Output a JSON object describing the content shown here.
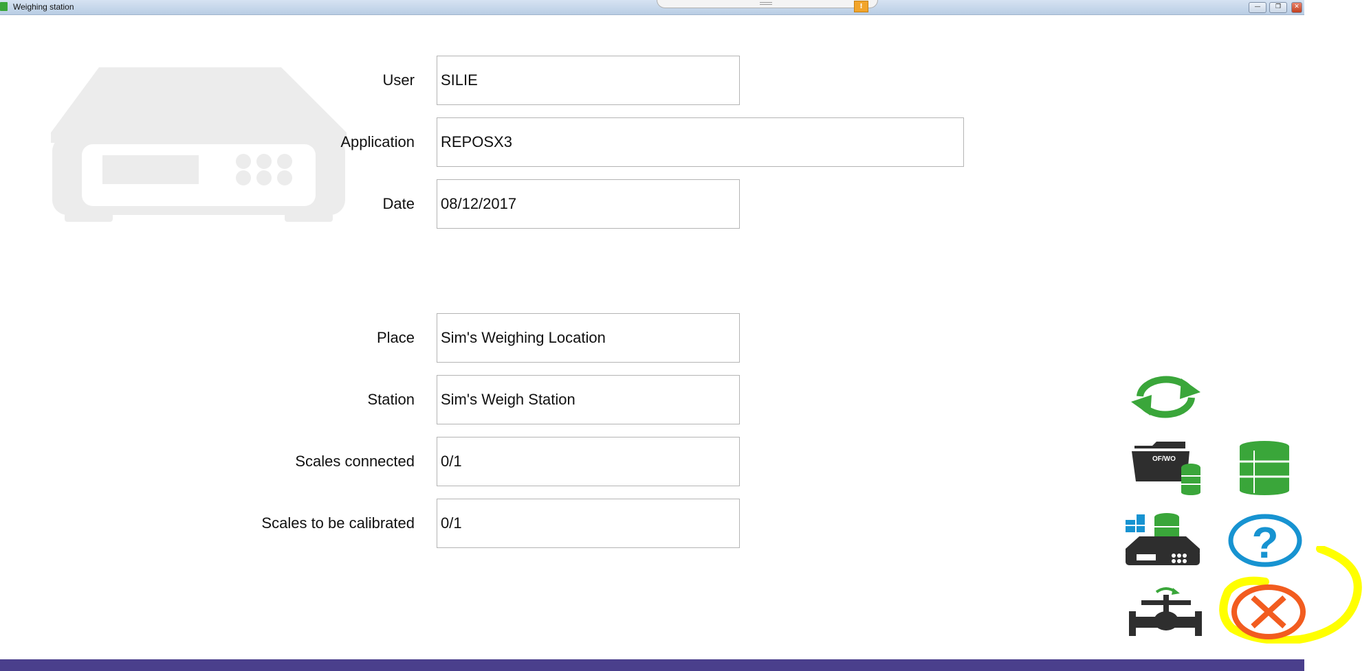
{
  "window": {
    "title": "Weighing station",
    "warning_glyph": "!",
    "minimize_glyph": "—",
    "restore_glyph": "❐",
    "close_glyph": "✕"
  },
  "form": {
    "user": {
      "label": "User",
      "value": "SILIE"
    },
    "application": {
      "label": "Application",
      "value": "REPOSX3"
    },
    "date": {
      "label": "Date",
      "value": "08/12/2017"
    },
    "place": {
      "label": "Place",
      "value": "Sim's Weighing Location"
    },
    "station": {
      "label": "Station",
      "value": "Sim's Weigh Station"
    },
    "scales_connected": {
      "label": "Scales connected",
      "value": "0/1"
    },
    "scales_to_calibrate": {
      "label": "Scales to be calibrated",
      "value": "0/1"
    }
  },
  "actions": {
    "work_order_folder_label": "OF/WO",
    "icons": [
      "refresh-icon",
      "work-order-folder-icon",
      "barrel-icon",
      "scale-weighing-icon",
      "help-icon",
      "valve-icon",
      "close-circle-icon"
    ]
  },
  "colors": {
    "green": "#3aa63a",
    "blue": "#1793d1",
    "orange": "#f25c1f",
    "dark": "#2e2e2e",
    "highlight": "#ffff00",
    "bottom_bar": "#4a3f8c"
  }
}
